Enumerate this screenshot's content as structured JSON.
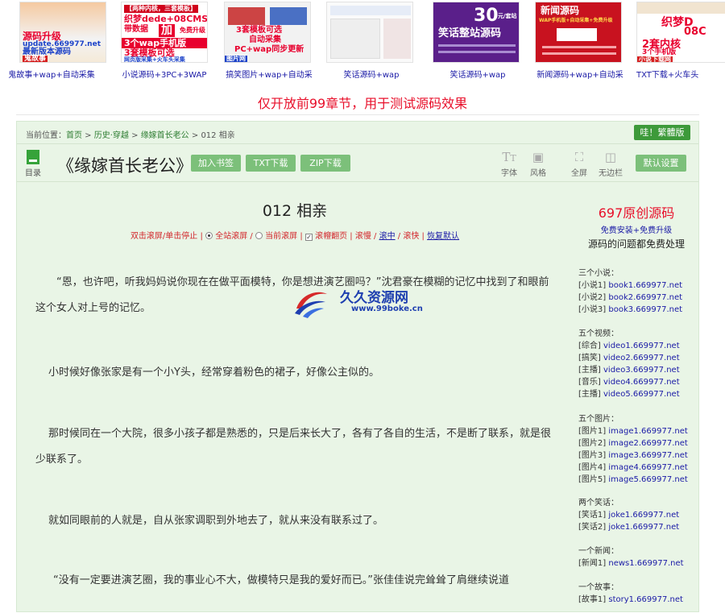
{
  "banners": [
    {
      "caption": "鬼故事+wap+自动采集",
      "lines": [
        "源码升级",
        "update.669977.net",
        "最新版本源码",
        "鬼故事"
      ]
    },
    {
      "caption": "小说源码+3PC+3WAP",
      "lines": [
        "【两种内核，三套模板】",
        "织梦dede+08CMS",
        "带数据",
        "加",
        "免费升级",
        "3个wap手机版",
        "3套模板可选",
        "网页版采集+火车头采集"
      ]
    },
    {
      "caption": "搞笑图片+wap+自动采",
      "lines": [
        "3套模板可选",
        "自动采集",
        "PC+wap同步更新",
        "图片网"
      ]
    },
    {
      "caption": "笑话源码+wap",
      "lines": []
    },
    {
      "caption": "笑话源码+wap",
      "lines": [
        "30",
        "元/套站",
        "笑话整站源码"
      ]
    },
    {
      "caption": "新闻源码+wap+自动采",
      "lines": [
        "新闻源码",
        "WAP手机版+自动采集+免费升级"
      ]
    },
    {
      "caption": "TXT下载+火车头",
      "lines": [
        "织梦D",
        "08C",
        "2套内核",
        "3个手机版",
        "小说下载网"
      ]
    }
  ],
  "notice": "仅开放前99章节，用于测试源码效果",
  "breadcrumb": {
    "prefix": "当前位置：",
    "home": "首页",
    "category": "历史·穿越",
    "book": "缘嫁首长老公",
    "chapter": "012 相亲",
    "sep": " > "
  },
  "traditional_button": "哇！繁體版",
  "toolbar": {
    "catalog": "目录",
    "book_title": "《缘嫁首长老公》",
    "bookmark": "加入书签",
    "txt_download": "TXT下载",
    "zip_download": "ZIP下载",
    "font": "字体",
    "style": "风格",
    "fullscreen": "全屏",
    "borderless": "无边栏",
    "default_settings": "默认设置"
  },
  "chapter_title": "012 相亲",
  "scroll_controls": {
    "hint": "双击滚屏/单击停止 |",
    "site_scroll": "全站滚屏 /",
    "current_scroll": "当前滚屏 |",
    "page_scroll": "滚㡧翻页 |",
    "slow": "滚慢",
    "sep1": " / ",
    "medium": "滚中",
    "sep2": " / ",
    "fast": "滚快",
    "sep3": " | ",
    "restore": "恢复默认"
  },
  "paragraphs": [
    "“恩，也许吧，听我妈妈说你现在在做平面模特，你是想进演艺圈吗？”沈君豪在模糊的记忆中找到了和眼前这个女人对上号的记忆。",
    "小时候好像张家是有一个小Y头，经常穿着粉色的裙子，好像公主似的。",
    "那时候同在一个大院，很多小孩子都是熟悉的，只是后来长大了，各有了各自的生活，不是断了联系，就是很少联系了。",
    "就如同眼前的人就是，自从张家调职到外地去了，就从来没有联系过了。",
    "“没有一定要进演艺圈，我的事业心不大，做模特只是我的爱好而已。”张佳佳说完耸耸了肩继续说道"
  ],
  "watermark": {
    "name": "久久资源网",
    "url": "www.99boke.cn"
  },
  "side": {
    "title": "697原创源码",
    "free": "免费安装+免费升级",
    "note": "源码的问题都免费处理",
    "groups": [
      {
        "head": "三个小说：",
        "rows": [
          [
            "[小说1]",
            "book1.669977.net"
          ],
          [
            "[小说2]",
            "book2.669977.net"
          ],
          [
            "[小说3]",
            "book3.669977.net"
          ]
        ]
      },
      {
        "head": "五个视频：",
        "rows": [
          [
            "[综合]",
            "video1.669977.net"
          ],
          [
            "[搞笑]",
            "video2.669977.net"
          ],
          [
            "[主播]",
            "video3.669977.net"
          ],
          [
            "[音乐]",
            "video4.669977.net"
          ],
          [
            "[主播]",
            "video5.669977.net"
          ]
        ]
      },
      {
        "head": "五个图片：",
        "rows": [
          [
            "[图片1]",
            "image1.669977.net"
          ],
          [
            "[图片2]",
            "image2.669977.net"
          ],
          [
            "[图片3]",
            "image3.669977.net"
          ],
          [
            "[图片4]",
            "image4.669977.net"
          ],
          [
            "[图片5]",
            "image5.669977.net"
          ]
        ]
      },
      {
        "head": "两个笑话：",
        "rows": [
          [
            "[笑话1]",
            "joke1.669977.net"
          ],
          [
            "[笑话2]",
            "joke1.669977.net"
          ]
        ]
      },
      {
        "head": "一个新闻：",
        "rows": [
          [
            "[新闻1]",
            "news1.669977.net"
          ]
        ]
      },
      {
        "head": "一个故事：",
        "rows": [
          [
            "[故事1]",
            "story1.669977.net"
          ]
        ]
      }
    ]
  },
  "colors": {
    "accent_green": "#3d9a3a",
    "light_green": "#7cc07a",
    "panel_bg": "#e9f5e6",
    "notice_red": "#e8102b",
    "link_blue": "#1a1aa6"
  }
}
